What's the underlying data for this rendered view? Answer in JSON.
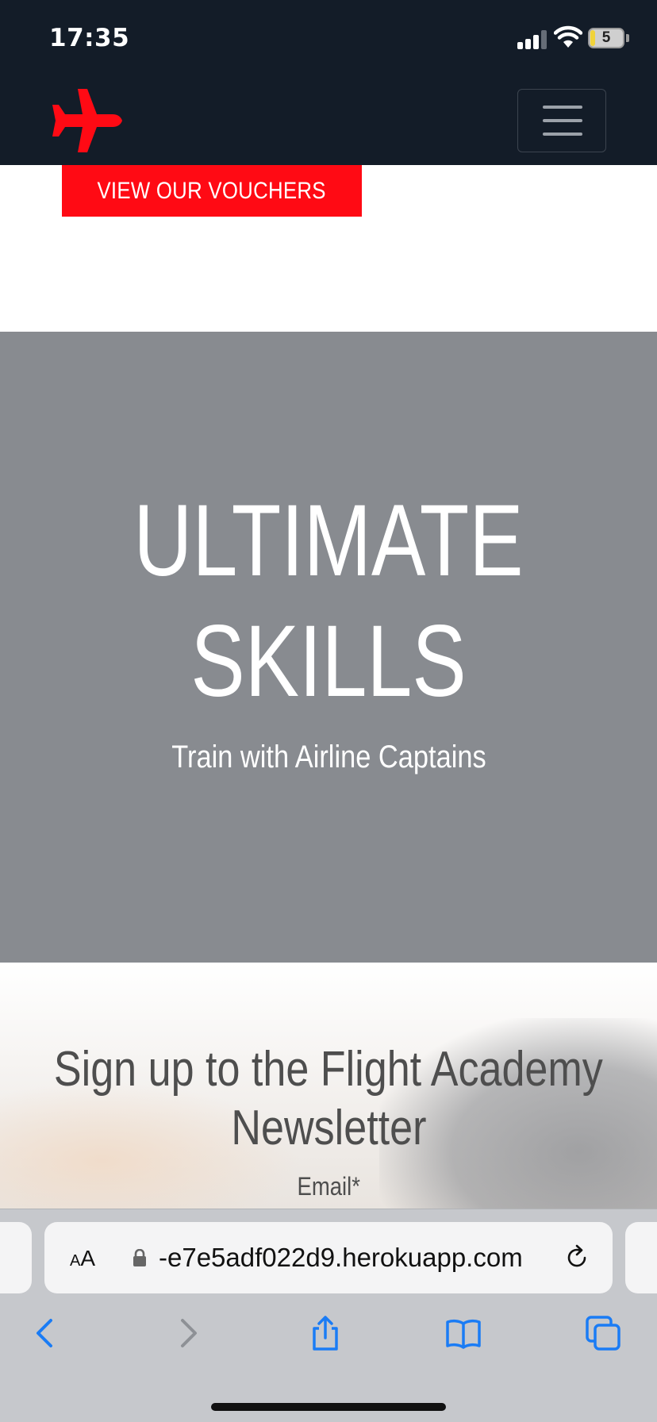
{
  "status_bar": {
    "time": "17:35",
    "battery_level": "5"
  },
  "header": {
    "logo_icon": "airplane-icon",
    "menu_icon": "hamburger-menu-icon",
    "brand_color": "#ff0a14",
    "background_color": "#131c28"
  },
  "voucher": {
    "button_label": "VIEW OUR VOUCHERS"
  },
  "hero": {
    "title_line1": "ULTIMATE",
    "title_line2": "SKILLS",
    "subtitle": "Train with Airline Captains",
    "background_color": "#888b90"
  },
  "newsletter": {
    "title_line1": "Sign up to the Flight Academy",
    "title_line2": "Newsletter",
    "email_label": "Email*"
  },
  "browser": {
    "text_size_label_small": "A",
    "text_size_label_large": "A",
    "url": "-e7e5adf022d9.herokuapp.com",
    "accent_color": "#1a7cf5"
  }
}
